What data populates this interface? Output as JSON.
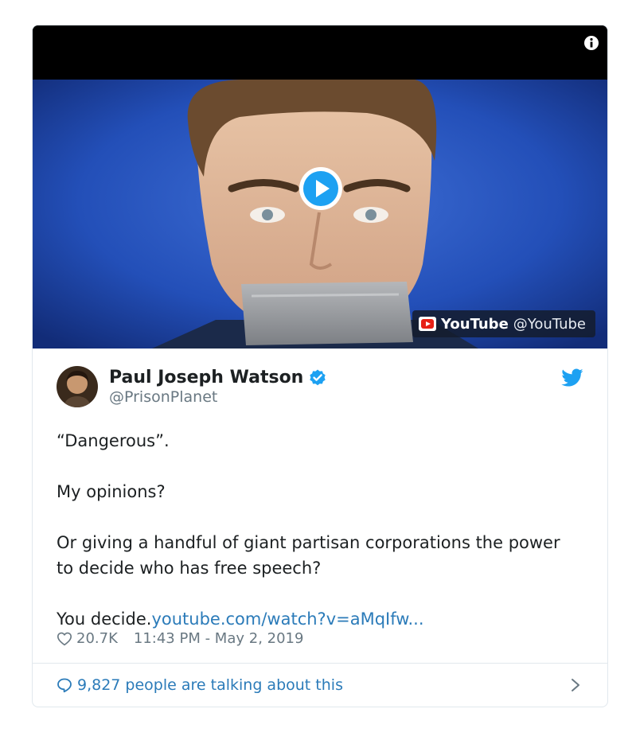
{
  "video": {
    "source_name": "YouTube",
    "source_handle": "@YouTube"
  },
  "tweet": {
    "author_name": "Paul Joseph Watson",
    "author_handle": "@PrisonPlanet",
    "verified": true,
    "paragraphs": [
      "“Dangerous”.",
      "My opinions?",
      "Or giving a handful of giant partisan corporations the power to decide who has free speech?"
    ],
    "last_line_text": "You decide.",
    "link_text": "youtube.com/watch?v=aMqIfw...",
    "likes": "20.7K",
    "timestamp": "11:43 PM - May 2, 2019",
    "talking_text": "9,827 people are talking about this"
  },
  "colors": {
    "link": "#2b7bb9",
    "twitter_blue": "#1da1f2",
    "muted": "#697882"
  }
}
